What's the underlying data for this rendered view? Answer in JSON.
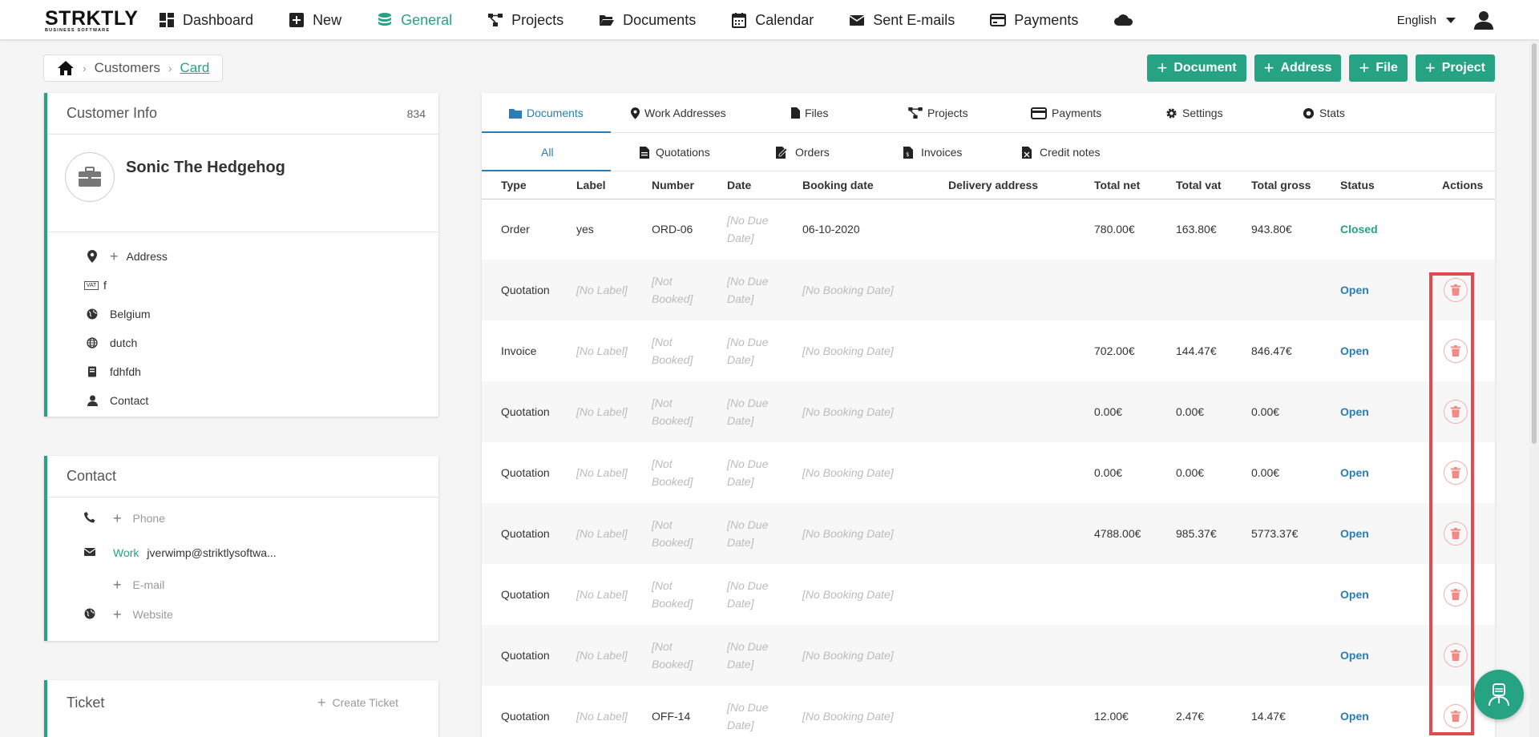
{
  "logo": {
    "main": "STRKTLY",
    "sub": "BUSINESS SOFTWARE"
  },
  "nav": {
    "items": [
      {
        "label": "Dashboard",
        "icon": "dashboard-icon"
      },
      {
        "label": "New",
        "icon": "plus-square-icon"
      },
      {
        "label": "General",
        "icon": "database-icon",
        "active": true
      },
      {
        "label": "Projects",
        "icon": "project-diagram-icon"
      },
      {
        "label": "Documents",
        "icon": "folder-open-icon"
      },
      {
        "label": "Calendar",
        "icon": "calendar-icon"
      },
      {
        "label": "Sent E-mails",
        "icon": "envelope-icon"
      },
      {
        "label": "Payments",
        "icon": "credit-card-icon"
      }
    ],
    "language": "English"
  },
  "breadcrumb": {
    "customers": "Customers",
    "card": "Card"
  },
  "actions": {
    "document": "Document",
    "address": "Address",
    "file": "File",
    "project": "Project"
  },
  "customer_info": {
    "title": "Customer Info",
    "count": "834",
    "name": "Sonic The Hedgehog",
    "address_label": "Address",
    "vat_badge": "VAT",
    "vat": "f",
    "country": "Belgium",
    "language": "dutch",
    "register": "fdhfdh",
    "contact": "Contact"
  },
  "contact_card": {
    "title": "Contact",
    "phone_placeholder": "Phone",
    "email_type": "Work",
    "email": "jverwimp@striktlysoftwa...",
    "email_placeholder": "E-mail",
    "website_placeholder": "Website"
  },
  "ticket_card": {
    "title": "Ticket",
    "create_label": "Create Ticket"
  },
  "tabs": [
    "Documents",
    "Work Addresses",
    "Files",
    "Projects",
    "Payments",
    "Settings",
    "Stats"
  ],
  "subtabs": [
    "All",
    "Quotations",
    "Orders",
    "Invoices",
    "Credit notes"
  ],
  "table": {
    "columns": [
      "Type",
      "Label",
      "Number",
      "Date",
      "Booking date",
      "Delivery address",
      "Total net",
      "Total vat",
      "Total gross",
      "Status",
      "Actions"
    ],
    "rows": [
      {
        "type": "Order",
        "label": "yes",
        "number": "ORD-06",
        "date": "[No Due Date]",
        "booking": "06-10-2020",
        "delivery": "",
        "net": "780.00€",
        "vat": "163.80€",
        "gross": "943.80€",
        "status": "Closed"
      },
      {
        "type": "Quotation",
        "label": "[No Label]",
        "number": "[Not Booked]",
        "date": "[No Due Date]",
        "booking": "[No Booking Date]",
        "delivery": "",
        "net": "",
        "vat": "",
        "gross": "",
        "status": "Open"
      },
      {
        "type": "Invoice",
        "label": "[No Label]",
        "number": "[Not Booked]",
        "date": "[No Due Date]",
        "booking": "[No Booking Date]",
        "delivery": "",
        "net": "702.00€",
        "vat": "144.47€",
        "gross": "846.47€",
        "status": "Open"
      },
      {
        "type": "Quotation",
        "label": "[No Label]",
        "number": "[Not Booked]",
        "date": "[No Due Date]",
        "booking": "[No Booking Date]",
        "delivery": "",
        "net": "0.00€",
        "vat": "0.00€",
        "gross": "0.00€",
        "status": "Open"
      },
      {
        "type": "Quotation",
        "label": "[No Label]",
        "number": "[Not Booked]",
        "date": "[No Due Date]",
        "booking": "[No Booking Date]",
        "delivery": "",
        "net": "0.00€",
        "vat": "0.00€",
        "gross": "0.00€",
        "status": "Open"
      },
      {
        "type": "Quotation",
        "label": "[No Label]",
        "number": "[Not Booked]",
        "date": "[No Due Date]",
        "booking": "[No Booking Date]",
        "delivery": "",
        "net": "4788.00€",
        "vat": "985.37€",
        "gross": "5773.37€",
        "status": "Open"
      },
      {
        "type": "Quotation",
        "label": "[No Label]",
        "number": "[Not Booked]",
        "date": "[No Due Date]",
        "booking": "[No Booking Date]",
        "delivery": "",
        "net": "",
        "vat": "",
        "gross": "",
        "status": "Open"
      },
      {
        "type": "Quotation",
        "label": "[No Label]",
        "number": "[Not Booked]",
        "date": "[No Due Date]",
        "booking": "[No Booking Date]",
        "delivery": "",
        "net": "",
        "vat": "",
        "gross": "",
        "status": "Open"
      },
      {
        "type": "Quotation",
        "label": "[No Label]",
        "number": "OFF-14",
        "date": "[No Due Date]",
        "booking": "[No Booking Date]",
        "delivery": "",
        "net": "12.00€",
        "vat": "2.47€",
        "gross": "14.47€",
        "status": "Open"
      }
    ]
  },
  "colors": {
    "brand": "#26a383",
    "link": "#2a7db5",
    "highlight": "#e24b4b",
    "delete": "#f08a84"
  }
}
